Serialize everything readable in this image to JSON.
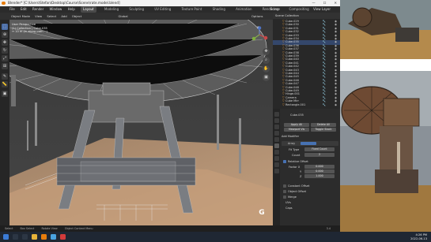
{
  "window": {
    "title": "Blender* [C:\\Users\\Stefan\\Desktop\\Course\\Scene\\rate.model.blend]",
    "controls": [
      "—",
      "☐",
      "✕"
    ]
  },
  "menubar": {
    "menus": [
      "File",
      "Edit",
      "Render",
      "Window",
      "Help"
    ],
    "workspace_tabs": [
      "Layout",
      "Modeling",
      "Sculpting",
      "UV Editing",
      "Texture Paint",
      "Shading",
      "Animation",
      "Rendering",
      "Compositing"
    ],
    "active_tab": "Layout",
    "scene": "Scene",
    "view_layer": "View Layer"
  },
  "toolbar": {
    "items": [
      "Object Mode",
      "View",
      "Select",
      "Add",
      "Object",
      "Global",
      "Options"
    ]
  },
  "viewport": {
    "info_line1": "User Perspective",
    "info_line2": "(1) Collection | Cube.035",
    "info_line3": "↔ 10 m (in along path ~)",
    "gizmo_labels": [
      "X",
      "Y",
      "Z"
    ],
    "nav_buttons": [
      "✥",
      "⌕",
      "✋",
      "▣"
    ],
    "g_label": "G"
  },
  "outliner": {
    "header": "Scene Collection",
    "rows": [
      {
        "name": "Cube.029",
        "selected": false
      },
      {
        "name": "Cube.030",
        "selected": false
      },
      {
        "name": "Cube.031",
        "selected": false
      },
      {
        "name": "Cube.032",
        "selected": false
      },
      {
        "name": "Cube.033",
        "selected": false
      },
      {
        "name": "Cube.034",
        "selected": false
      },
      {
        "name": "Cube.035",
        "selected": true
      },
      {
        "name": "Cube.036",
        "selected": false
      },
      {
        "name": "Cube.037",
        "selected": false
      },
      {
        "name": "Cube.038",
        "selected": false
      },
      {
        "name": "Cube.039",
        "selected": false
      },
      {
        "name": "Cube.040",
        "selected": false
      },
      {
        "name": "Cube.041",
        "selected": false
      },
      {
        "name": "Cube.042",
        "selected": false
      },
      {
        "name": "Cube.043",
        "selected": false
      },
      {
        "name": "Cube.044",
        "selected": false
      },
      {
        "name": "Cube.045",
        "selected": false
      },
      {
        "name": "Cube.046",
        "selected": false
      },
      {
        "name": "Cube.047",
        "selected": false
      },
      {
        "name": "Cube.048",
        "selected": false
      },
      {
        "name": "Cube.049",
        "selected": false
      },
      {
        "name": "Hinge.001",
        "selected": false
      },
      {
        "name": "Camera",
        "selected": false
      },
      {
        "name": "Cube Mirr",
        "selected": false
      },
      {
        "name": "Rectangle.001",
        "selected": false
      }
    ]
  },
  "properties": {
    "object_name": "Cube.035",
    "buttons": [
      "Apply All",
      "Delete All",
      "Viewport Vis",
      "Toggle Stack"
    ],
    "add_modifier": "Add Modifier",
    "modifier_name": "Array",
    "fit_type_label": "Fit Type",
    "fit_type_value": "Fixed Count",
    "count_label": "Count",
    "count_value": "2",
    "relative_offset": "Relative Offset",
    "factor_x_label": "Factor X",
    "factor_x_value": "0.000",
    "factor_y_label": "Y",
    "factor_y_value": "0.000",
    "factor_z_label": "Z",
    "factor_z_value": "1.000",
    "constant_offset": "Constant Offset",
    "object_offset": "Object Offset",
    "merge": "Merge",
    "uvs": "UVs",
    "caps": "Caps"
  },
  "statusbar": {
    "items": [
      "Select",
      "Box Select",
      "Rotate View",
      "Object Context Menu",
      "3.4"
    ]
  },
  "taskbar": {
    "time": "4:26 PM",
    "date": "2022-06-13"
  },
  "colors": {
    "accent": "#4772b3",
    "selection": "#34476b",
    "blender_orange": "#e87d0d"
  }
}
